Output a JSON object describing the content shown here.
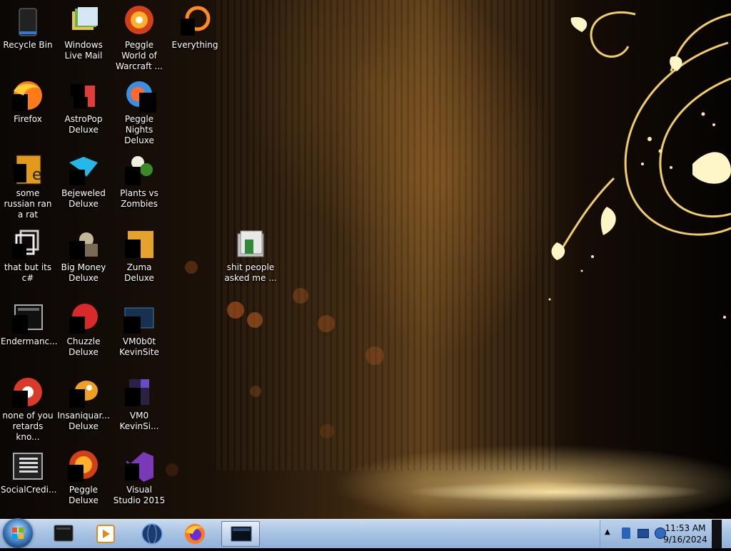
{
  "desktop": {
    "icons": [
      {
        "label": "Recycle Bin",
        "col": 0,
        "row": 0,
        "icon": "recycle-bin-icon"
      },
      {
        "label": "Windows Live Mail",
        "col": 1,
        "row": 0,
        "icon": "mail-icon"
      },
      {
        "label": "Peggle World of Warcraft ...",
        "col": 2,
        "row": 0,
        "icon": "peggle-icon"
      },
      {
        "label": "Everything",
        "col": 3,
        "row": 0,
        "icon": "search-everything-icon"
      },
      {
        "label": "Firefox",
        "col": 0,
        "row": 1,
        "icon": "firefox-icon"
      },
      {
        "label": "AstroPop Deluxe",
        "col": 1,
        "row": 1,
        "icon": "astropop-icon"
      },
      {
        "label": "Peggle Nights Deluxe",
        "col": 2,
        "row": 1,
        "icon": "peggle-nights-icon"
      },
      {
        "label": "some russian ran a rat",
        "col": 0,
        "row": 2,
        "icon": "text-file-icon"
      },
      {
        "label": "Bejeweled Deluxe",
        "col": 1,
        "row": 2,
        "icon": "bejeweled-icon"
      },
      {
        "label": "Plants vs Zombies",
        "col": 2,
        "row": 2,
        "icon": "plants-vs-zombies-icon"
      },
      {
        "label": "that but its c#",
        "col": 0,
        "row": 3,
        "icon": "copy-icon"
      },
      {
        "label": "Big Money Deluxe",
        "col": 1,
        "row": 3,
        "icon": "big-money-icon"
      },
      {
        "label": "Zuma Deluxe",
        "col": 2,
        "row": 3,
        "icon": "zuma-icon"
      },
      {
        "label": "shit people asked me ...",
        "col": 4,
        "row": 3,
        "icon": "folder-icon"
      },
      {
        "label": "Endermanc...",
        "col": 0,
        "row": 4,
        "icon": "app-window-icon"
      },
      {
        "label": "Chuzzle Deluxe",
        "col": 1,
        "row": 4,
        "icon": "chuzzle-icon"
      },
      {
        "label": "VM0b0t KevinSite",
        "col": 2,
        "row": 4,
        "icon": "vm-icon"
      },
      {
        "label": "none of you retards kno...",
        "col": 0,
        "row": 5,
        "icon": "chrome-icon"
      },
      {
        "label": "Insaniquar... Deluxe",
        "col": 1,
        "row": 5,
        "icon": "fish-icon"
      },
      {
        "label": "VM0 KevinSi...",
        "col": 2,
        "row": 5,
        "icon": "file-icon"
      },
      {
        "label": "SocialCredi...",
        "col": 0,
        "row": 6,
        "icon": "document-window-icon"
      },
      {
        "label": "Peggle Deluxe",
        "col": 1,
        "row": 6,
        "icon": "peggle-deluxe-icon"
      },
      {
        "label": "Visual Studio 2015",
        "col": 2,
        "row": 6,
        "icon": "visual-studio-icon"
      }
    ]
  },
  "taskbar": {
    "pinned": [
      {
        "icon": "terminal-icon",
        "active": false
      },
      {
        "icon": "media-player-icon",
        "active": false
      },
      {
        "icon": "globe-icon",
        "active": false
      },
      {
        "icon": "firefox-icon",
        "active": false
      },
      {
        "icon": "window-app-icon",
        "active": true
      }
    ],
    "tray_icons": [
      "show-hidden-icons-arrow",
      "network-drive-icon",
      "network-icon",
      "volume-icon"
    ],
    "clock": {
      "time": "11:53 AM",
      "date": "9/16/2024"
    }
  },
  "colors": {
    "accent": "#f0a030",
    "taskbar": "#a9c4e4",
    "label_text": "#ffffff"
  }
}
